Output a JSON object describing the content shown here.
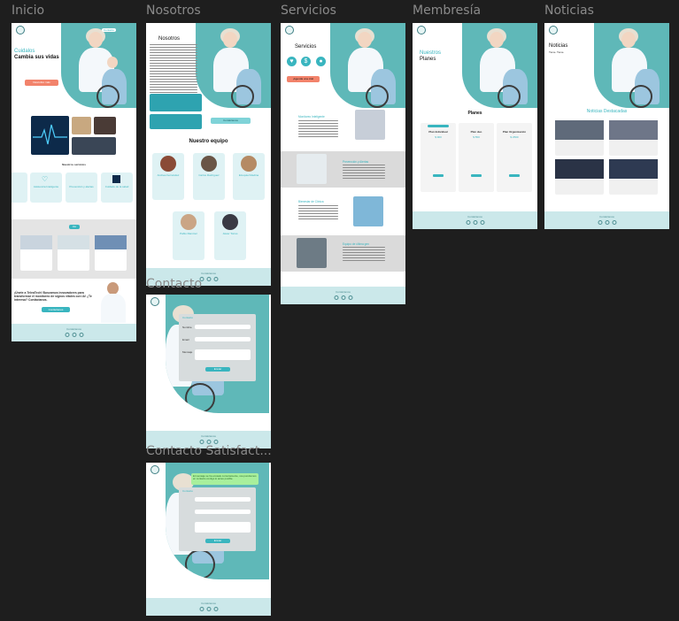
{
  "frames": {
    "inicio": {
      "label": "Inicio",
      "hero_title_1": "Cuidalos",
      "hero_title_2": "Cambia sus vidas",
      "hero_button": "Descubre más",
      "section_title": "Nuestros servicios",
      "services": [
        "Monitoreo",
        "Asistencia Inteligente",
        "Prevención y alertas",
        "Cuidado de la salud"
      ],
      "cta_button": "Ver",
      "partner_text": "¡Únete a TeleaTech! Buscamos innovadores para transformar el monitoreo de signos vitales con IA! ¿Te interesa? Contáctanos.",
      "partner_button": "Contáctanos"
    },
    "nosotros": {
      "label": "Nosotros",
      "title": "Nosotros",
      "team_title": "Nuestro equipo",
      "team_button": "Contáctanos",
      "members": [
        "Andrea Fernández",
        "Carlos Rodríguez",
        "Ezequiel Medina",
        "Pablo Ramírez",
        "Javier Torres"
      ]
    },
    "servicios": {
      "label": "Servicios",
      "title": "Servicios",
      "button": "¡Agenda una cita!",
      "items": [
        "Monitoreo Inteligente",
        "Prevención y Alertas",
        "Bienestar de Clínica",
        "Equipo de última gen"
      ]
    },
    "membresia": {
      "label": "Membresía",
      "title_1": "Nuestros",
      "title_2": "Planes",
      "plans_title": "Planes",
      "plans": [
        {
          "name": "Plan Individual",
          "price": "$ 900"
        },
        {
          "name": "Plan duo",
          "price": "$ 550"
        },
        {
          "name": "Plan Organización",
          "price": "$ 2500"
        }
      ]
    },
    "noticias": {
      "label": "Noticias",
      "title": "Noticias",
      "subtitle": "Tiene. Tiene.",
      "featured_title": "Noticias Destacadas"
    },
    "contacto": {
      "label": "Contacto",
      "form_title": "Contacto",
      "fields": [
        "Nombre",
        "Email",
        "Mensaje"
      ],
      "submit": "Enviar"
    },
    "contacto_satisfactorio": {
      "label": "Contacto Satisfact...",
      "success_msg": "El mensaje se ha enviado correctamente, nos pondremos en contacto contigo lo antes posible.",
      "form_title": "Contacto",
      "submit": "Enviar"
    }
  },
  "footer": {
    "text": "Contáctanos",
    "brand": "TeleaTech"
  },
  "colors": {
    "teal": "#5fb8b8",
    "accent": "#39b5bf",
    "coral": "#f2836b",
    "footer": "#cbe8ea",
    "canvas": "#1e1e1e"
  }
}
